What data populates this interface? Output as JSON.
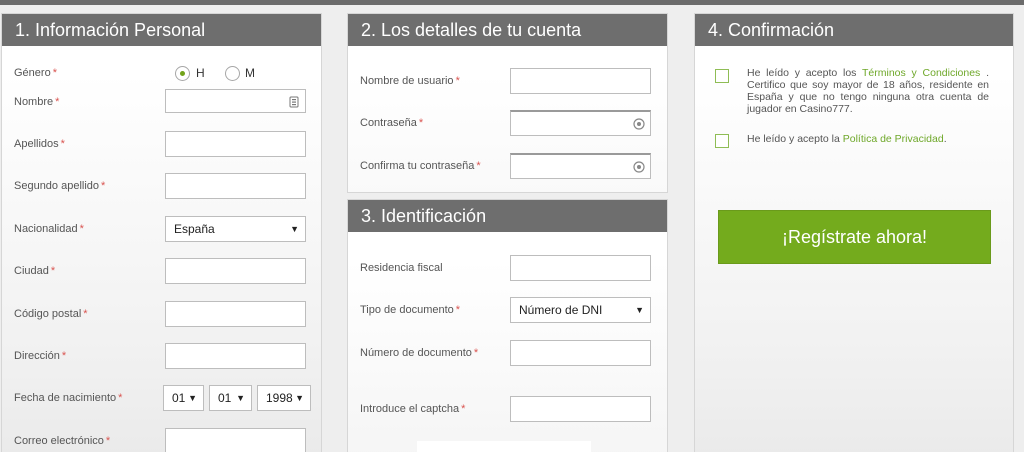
{
  "panels": {
    "personal": {
      "title": "1. Información Personal",
      "gender_label": "Género",
      "gender_options": [
        "H",
        "M"
      ],
      "gender_selected": "H",
      "fields": {
        "nombre": "Nombre",
        "apellidos": "Apellidos",
        "segundo_apellido": "Segundo apellido",
        "nacionalidad": "Nacionalidad",
        "ciudad": "Ciudad",
        "codigo_postal": "Código postal",
        "direccion": "Dirección",
        "fecha_nacimiento": "Fecha de nacimiento",
        "correo": "Correo electrónico"
      },
      "nacionalidad_value": "España",
      "birth_day": "01",
      "birth_month": "01",
      "birth_year": "1998"
    },
    "account": {
      "title": "2. Los detalles de tu cuenta",
      "fields": {
        "usuario": "Nombre de usuario",
        "contrasena": "Contraseña",
        "confirma": "Confirma tu contraseña"
      }
    },
    "identification": {
      "title": "3. Identificación",
      "fields": {
        "residencia": "Residencia fiscal",
        "tipo_documento": "Tipo de documento",
        "numero_documento": "Número de documento",
        "captcha": "Introduce el captcha"
      },
      "tipo_documento_value": "Número de DNI"
    },
    "confirmation": {
      "title": "4. Confirmación",
      "terms_prefix": "He leído y acepto los ",
      "terms_link": "Términos y Condiciones",
      "terms_suffix": " . Certifico que soy mayor de 18 años, residente en España y que no tengo ninguna otra cuenta de jugador en Casino777.",
      "privacy_prefix": "He leído y acepto la ",
      "privacy_link": "Política de Privacidad",
      "privacy_suffix": ".",
      "register_button": "¡Regístrate ahora!"
    }
  },
  "required_mark": "*",
  "colors": {
    "header_bg": "#6e6e6e",
    "accent_green": "#74ab1d",
    "link_green": "#6fa82a",
    "required_red": "#d9534f"
  },
  "icons": {
    "contact_card": "contact-card-icon",
    "password_reveal": "password-reveal-icon",
    "dropdown": "chevron-down-icon"
  }
}
